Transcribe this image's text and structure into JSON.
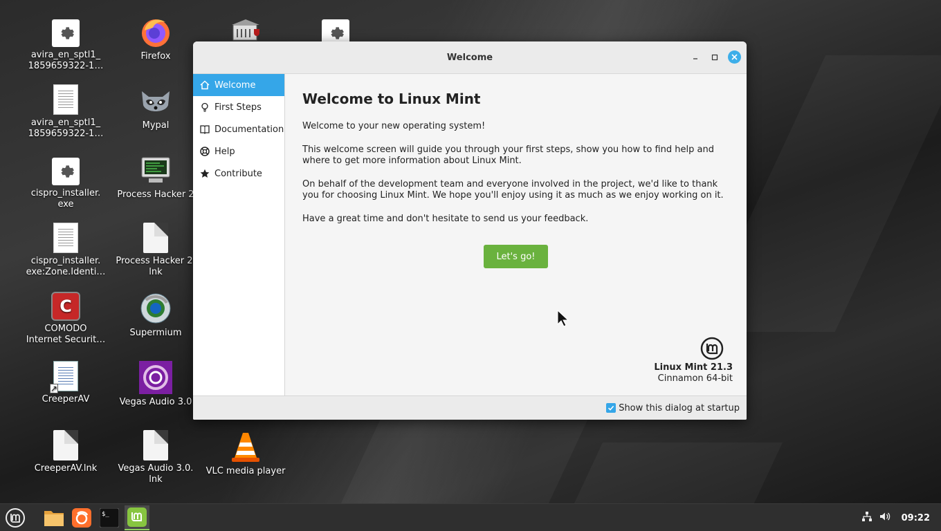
{
  "desktop": {
    "icons": [
      {
        "label": "avira_en_sptl1_\n1859659322-1…",
        "icon": "gear-icon"
      },
      {
        "label": "Firefox",
        "icon": "firefox-icon"
      },
      {
        "label": "",
        "icon": "wine-icon"
      },
      {
        "label": "",
        "icon": "gear-icon"
      },
      {
        "label": "avira_en_sptl1_\n1859659322-1…",
        "icon": "document-icon"
      },
      {
        "label": "Mypal",
        "icon": "raccoon-icon"
      },
      {
        "label": "cispro_installer.\nexe",
        "icon": "gear-icon"
      },
      {
        "label": "Process Hacker 2",
        "icon": "monitor-icon"
      },
      {
        "label": "cispro_installer.\nexe:Zone.Identi…",
        "icon": "document-icon"
      },
      {
        "label": "Process Hacker 2.\nlnk",
        "icon": "file-icon"
      },
      {
        "label": "COMODO\nInternet Securit…",
        "icon": "comodo-icon"
      },
      {
        "label": "Supermium",
        "icon": "supermium-icon"
      },
      {
        "label": "CreeperAV",
        "icon": "shortcut-document-icon"
      },
      {
        "label": "Vegas Audio 3.0",
        "icon": "vegas-icon"
      },
      {
        "label": "CreeperAV.lnk",
        "icon": "file-icon"
      },
      {
        "label": "Vegas Audio 3.0.\nlnk",
        "icon": "file-icon"
      },
      {
        "label": "VLC media player",
        "icon": "vlc-icon"
      }
    ]
  },
  "window": {
    "title": "Welcome",
    "sidebar": [
      {
        "label": "Welcome",
        "icon": "home-icon"
      },
      {
        "label": "First Steps",
        "icon": "lightbulb-icon"
      },
      {
        "label": "Documentation",
        "icon": "book-icon"
      },
      {
        "label": "Help",
        "icon": "lifebuoy-icon"
      },
      {
        "label": "Contribute",
        "icon": "star-icon"
      }
    ],
    "heading": "Welcome to Linux Mint",
    "paragraphs": [
      "Welcome to your new operating system!",
      "This welcome screen will guide you through your first steps, show you how to find help and where to get more information about Linux Mint.",
      "On behalf of the development team and everyone involved in the project, we'd like to thank you for choosing Linux Mint. We hope you'll enjoy using it as much as we enjoy working on it.",
      "Have a great time and don't hesitate to send us your feedback."
    ],
    "button_label": "Let's go!",
    "version": "Linux Mint 21.3",
    "edition": "Cinnamon 64-bit",
    "startup_checkbox_label": "Show this dialog at startup",
    "startup_checked": true
  },
  "taskbar": {
    "clock": "09:22",
    "apps": [
      "menu-icon",
      "files-icon",
      "firefox-icon",
      "terminal-icon",
      "mintwelcome-icon"
    ]
  },
  "colors": {
    "accent": "#35a6e8",
    "button_green": "#6ab23e"
  }
}
